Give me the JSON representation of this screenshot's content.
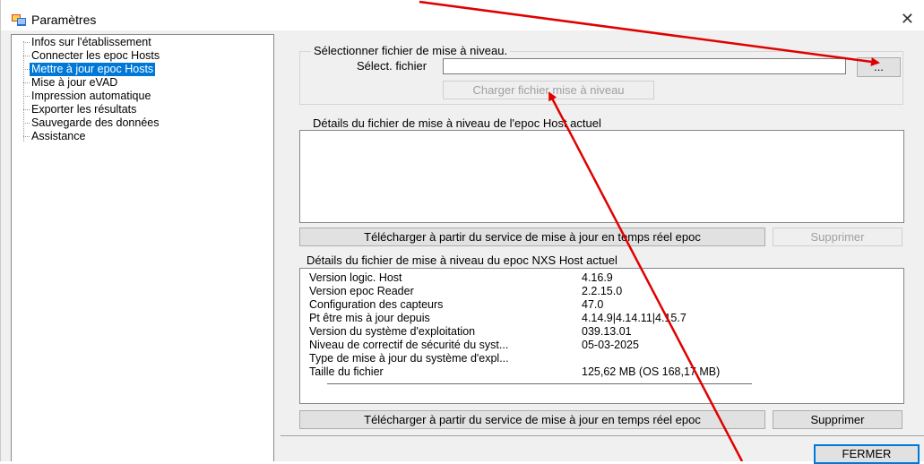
{
  "window": {
    "title": "Paramètres",
    "close_glyph": "✕",
    "app_icon": "settings-window-icon"
  },
  "tree": {
    "items": [
      {
        "label": "Infos sur l'établissement",
        "selected": false
      },
      {
        "label": "Connecter les epoc Hosts",
        "selected": false
      },
      {
        "label": "Mettre à jour epoc Hosts",
        "selected": true
      },
      {
        "label": "Mise à jour eVAD",
        "selected": false
      },
      {
        "label": "Impression automatique",
        "selected": false
      },
      {
        "label": "Exporter les résultats",
        "selected": false
      },
      {
        "label": "Sauvegarde des données",
        "selected": false
      },
      {
        "label": "Assistance",
        "selected": false
      }
    ]
  },
  "upgrade_group": {
    "title": "Sélectionner fichier de mise à niveau.",
    "file_label": "Sélect. fichier",
    "file_value": "",
    "browse_label": "...",
    "load_label": "Charger fichier mise à niveau"
  },
  "current_host": {
    "title": "Détails du fichier de mise à niveau de l'epoc Host actuel",
    "download_label": "Télécharger à partir du service de mise à jour en temps réel epoc",
    "delete_label": "Supprimer"
  },
  "nxs_host": {
    "title": "Détails du fichier de mise à niveau du epoc NXS Host actuel",
    "rows": [
      {
        "key": "Version logic. Host",
        "value": "4.16.9"
      },
      {
        "key": "Version epoc Reader",
        "value": "2.2.15.0"
      },
      {
        "key": "Configuration des capteurs",
        "value": "47.0"
      },
      {
        "key": "Pt être mis à jour depuis",
        "value": "4.14.9|4.14.11|4.15.7"
      },
      {
        "key": "Version du système d'exploitation",
        "value": "039.13.01"
      },
      {
        "key": "Niveau de correctif de sécurité du syst...",
        "value": "05-03-2025"
      },
      {
        "key": "Type de mise à jour du système d'expl...",
        "value": ""
      },
      {
        "key": "Taille du fichier",
        "value": "125,62 MB (OS 168,17 MB)"
      }
    ],
    "download_label": "Télécharger à partir du service de mise à jour en temps réel epoc",
    "delete_label": "Supprimer"
  },
  "footer": {
    "close_label": "FERMER"
  },
  "colors": {
    "selection": "#0078d7",
    "annotation_arrow": "#e00000"
  }
}
